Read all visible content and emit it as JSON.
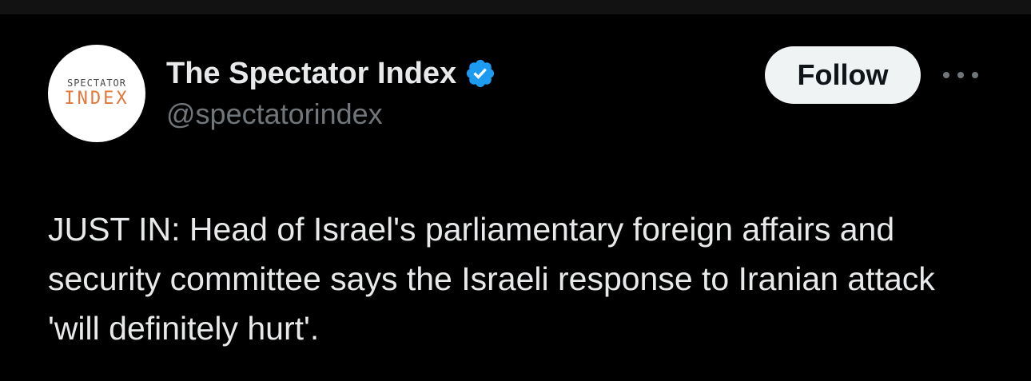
{
  "tweet": {
    "author": {
      "display_name": "The Spectator Index",
      "handle": "@spectatorindex",
      "verified": true,
      "verified_icon": "verified-badge-icon",
      "verified_color": "#1d9bf0",
      "avatar": {
        "line1": "SPECTATOR",
        "line2": "INDEX",
        "line1_color": "#4a4a4a",
        "line2_color": "#e1773a"
      }
    },
    "follow_label": "Follow",
    "more_icon": "more-options-icon",
    "text": "JUST IN: Head of Israel's parliamentary foreign affairs and security committee says the Israeli response to Iranian attack 'will definitely hurt'."
  },
  "colors": {
    "background": "#000000",
    "primary_text": "#e7e9ea",
    "secondary_text": "#71767b",
    "follow_button_bg": "#eff3f4",
    "follow_button_text": "#0f1419"
  }
}
